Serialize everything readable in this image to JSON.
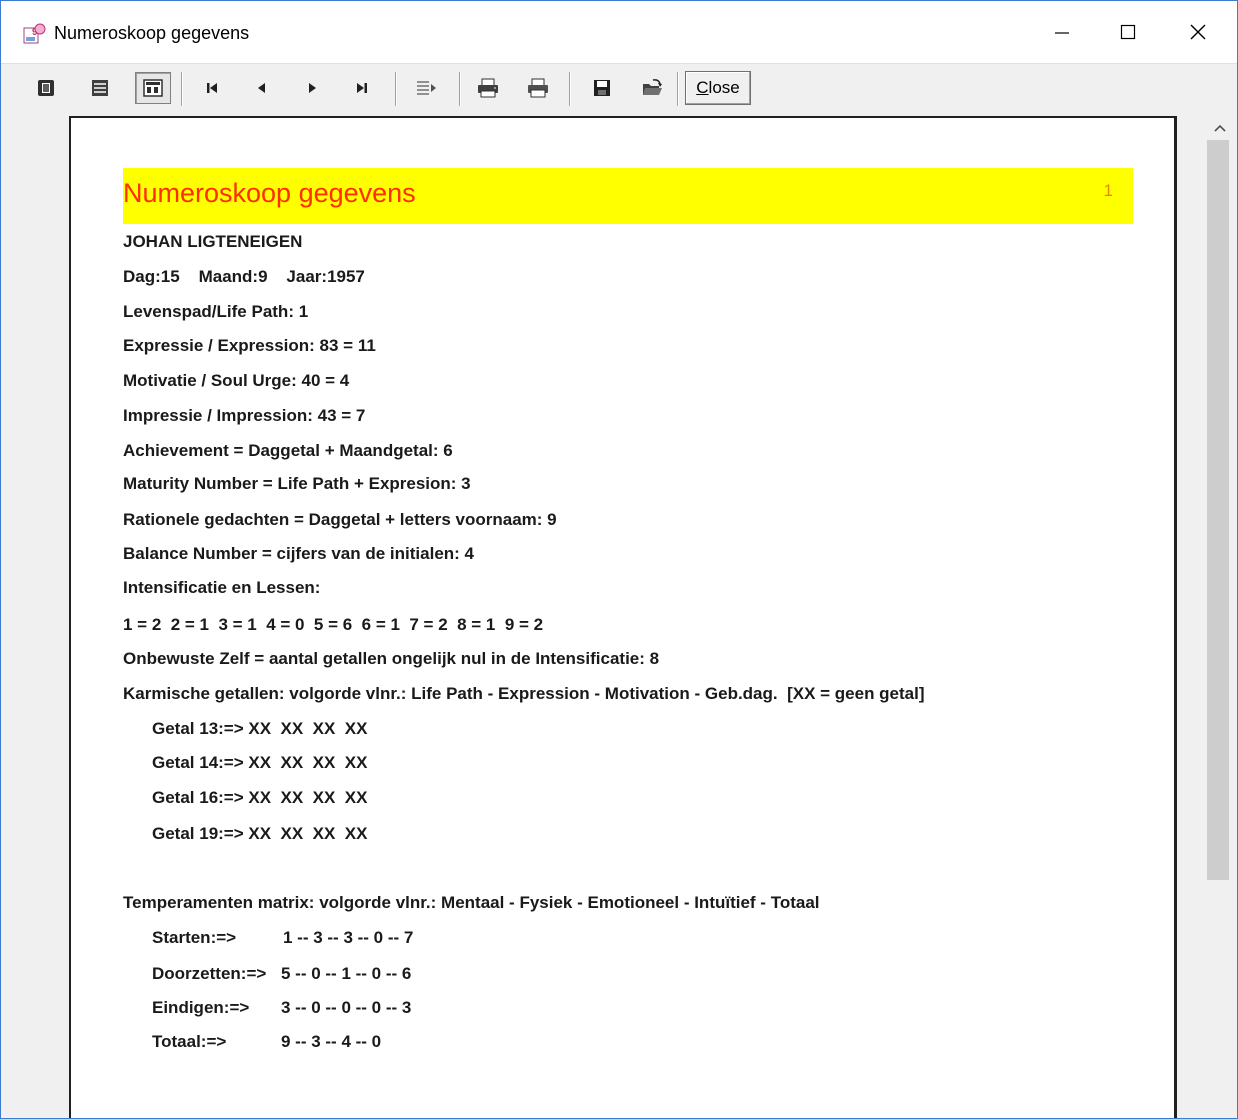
{
  "window": {
    "title": "Numeroskoop gegevens",
    "controls": {
      "minimize": "minimize",
      "maximize": "maximize",
      "close": "close"
    }
  },
  "toolbar": {
    "buttons": [
      "page-width",
      "whole-page",
      "page-setup",
      "first-page",
      "previous-page",
      "next-page",
      "last-page",
      "goto-page",
      "printer-setup",
      "print",
      "save",
      "open"
    ],
    "close_label_first": "C",
    "close_label_rest": "lose"
  },
  "report": {
    "title": "Numeroskoop gegevens",
    "page_number": "1",
    "name": "JOHAN LIGTENEIGEN",
    "date_line": "Dag:15    Maand:9    Jaar:1957",
    "lines": [
      "Levenspad/Life Path: 1",
      "Expressie / Expression: 83 = 11",
      "Motivatie / Soul Urge: 40 = 4",
      "Impressie / Impression: 43 = 7",
      "Achievement = Daggetal + Maandgetal: 6",
      "Maturity Number = Life Path + Expresion: 3",
      "Rationele gedachten = Daggetal + letters voornaam: 9",
      "Balance Number = cijfers van de initialen: 4",
      "Intensificatie en Lessen:",
      "1 = 2  2 = 1  3 = 1  4 = 0  5 = 6  6 = 1  7 = 2  8 = 1  9 = 2",
      "Onbewuste Zelf = aantal getallen ongelijk nul in de Intensificatie: 8",
      "Karmische getallen: volgorde vlnr.: Life Path - Expression - Motivation - Geb.dag.  [XX = geen getal]"
    ],
    "karmic": [
      "Getal 13:=> XX  XX  XX  XX",
      "Getal 14:=> XX  XX  XX  XX",
      "Getal 16:=> XX  XX  XX  XX",
      "Getal 19:=> XX  XX  XX  XX"
    ],
    "temperament_heading": "Temperamenten matrix: volgorde vlnr.: Mentaal - Fysiek - Emotioneel - Intuïtief - Totaal",
    "temperament": [
      {
        "label": "Starten:=>",
        "values": "1 -- 3 -- 3 -- 0 -- 7"
      },
      {
        "label": "Doorzetten:=>",
        "values": "5 -- 0 -- 1 -- 0 -- 6"
      },
      {
        "label": "Eindigen:=>",
        "values": "3 -- 0 -- 0 -- 0 -- 3"
      },
      {
        "label": "Totaal:=>",
        "values": "9 -- 3 -- 4 -- 0"
      }
    ]
  },
  "colors": {
    "banner_bg": "#ffff00",
    "banner_title": "#ff2d00",
    "page_number": "#e08a00"
  }
}
